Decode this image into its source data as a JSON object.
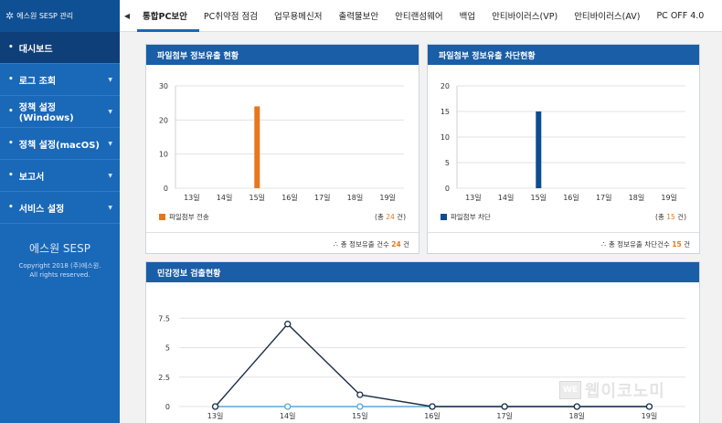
{
  "brand": {
    "label": "에스원 SESP 관리",
    "icon": "gear-icon"
  },
  "sidebar": {
    "items": [
      {
        "label": "대시보드",
        "active": true
      },
      {
        "label": "로그 조회"
      },
      {
        "label": "정책 설정(Windows)"
      },
      {
        "label": "정책 설정(macOS)"
      },
      {
        "label": "보고서"
      },
      {
        "label": "서비스 설정"
      }
    ],
    "footer_brand": "에스원 SESP",
    "copyright_line1": "Copyright 2018 (주)에스원.",
    "copyright_line2": "All rights reserved."
  },
  "topnav": {
    "tabs": [
      "통합PC보안",
      "PC취약점 점검",
      "업무용메신저",
      "출력물보안",
      "안티랜섬웨어",
      "백업",
      "안티바이러스(VP)",
      "안티바이러스(AV)",
      "PC OFF 4.0"
    ],
    "active_index": 0
  },
  "panel1": {
    "title": "파일첨부 정보유출 현황",
    "legend": "파일첨부 전송",
    "total_prefix": "(총 ",
    "total_value": "24",
    "total_suffix": " 건)",
    "foot_label": "총 정보유출 건수",
    "foot_value": "24",
    "foot_unit": "건"
  },
  "panel2": {
    "title": "파일첨부 정보유출 차단현황",
    "legend": "파일첨부 차단",
    "total_prefix": "(총 ",
    "total_value": "15",
    "total_suffix": " 건)",
    "foot_label": "총 정보유출 차단건수",
    "foot_value": "15",
    "foot_unit": "건"
  },
  "panel3": {
    "title": "민감정보 검출현황"
  },
  "chart_data": [
    {
      "type": "bar",
      "categories": [
        "13일",
        "14일",
        "15일",
        "16일",
        "17일",
        "18일",
        "19일"
      ],
      "series": [
        {
          "name": "파일첨부 전송",
          "values": [
            0,
            0,
            24,
            0,
            0,
            0,
            0
          ]
        }
      ],
      "yticks": [
        0,
        10,
        20,
        30
      ],
      "ylim": [
        0,
        30
      ],
      "color": "#e8761f",
      "grid": true
    },
    {
      "type": "bar",
      "categories": [
        "13일",
        "14일",
        "15일",
        "16일",
        "17일",
        "18일",
        "19일"
      ],
      "series": [
        {
          "name": "파일첨부 차단",
          "values": [
            0,
            0,
            15,
            0,
            0,
            0,
            0
          ]
        }
      ],
      "yticks": [
        0,
        5,
        10,
        15,
        20
      ],
      "ylim": [
        0,
        20
      ],
      "color": "#0e4c91",
      "grid": true
    },
    {
      "type": "line",
      "categories": [
        "13일",
        "14일",
        "15일",
        "16일",
        "17일",
        "18일",
        "19일"
      ],
      "series": [
        {
          "values": [
            0,
            7,
            1,
            0,
            0,
            0,
            0
          ],
          "color": "#1b2f4a"
        },
        {
          "values": [
            0,
            0,
            0,
            0,
            0,
            0,
            0
          ],
          "color": "#5aa6d8"
        }
      ],
      "yticks": [
        "0",
        "2.5",
        "5",
        "7.5"
      ],
      "ylim": [
        0,
        10
      ],
      "grid": true
    }
  ],
  "watermark": {
    "box": "WE",
    "text": "웹이코노미"
  }
}
